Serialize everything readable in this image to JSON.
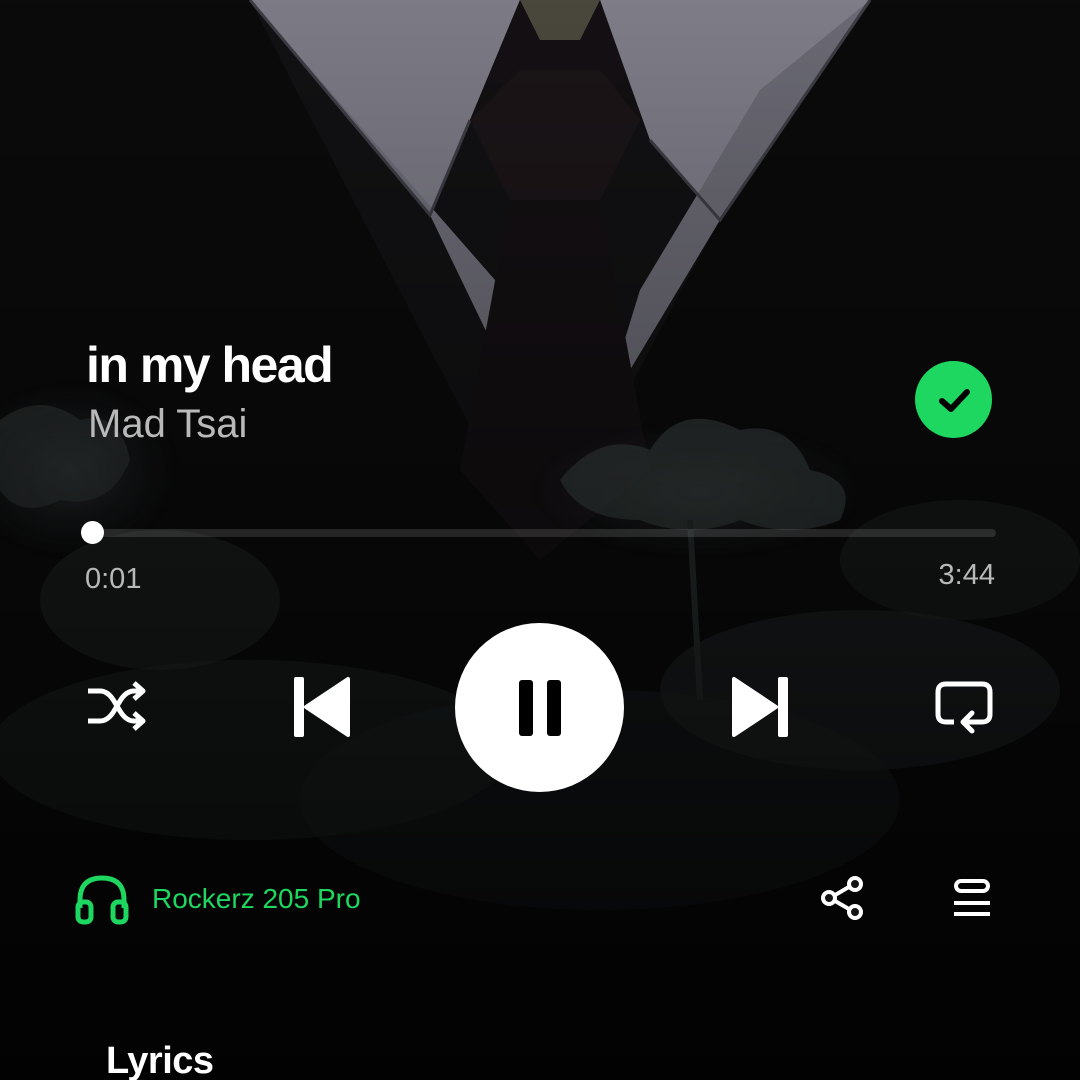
{
  "track": {
    "title": "in my head",
    "artist": "Mad Tsai",
    "liked": true
  },
  "playback": {
    "elapsed": "0:01",
    "total": "3:44",
    "progress_fraction": 0.0045,
    "state": "playing"
  },
  "controls": {
    "shuffle_icon": "shuffle-icon",
    "previous_icon": "skip-previous-icon",
    "pause_icon": "pause-icon",
    "next_icon": "skip-next-icon",
    "repeat_icon": "repeat-icon"
  },
  "device": {
    "name": "Rockerz 205 Pro",
    "icon": "headphones-icon"
  },
  "actions": {
    "share_icon": "share-icon",
    "queue_icon": "queue-icon"
  },
  "lyrics": {
    "title": "Lyrics"
  },
  "colors": {
    "accent": "#1ed760",
    "text_primary": "#ffffff",
    "text_secondary": "#b9b9b9"
  }
}
